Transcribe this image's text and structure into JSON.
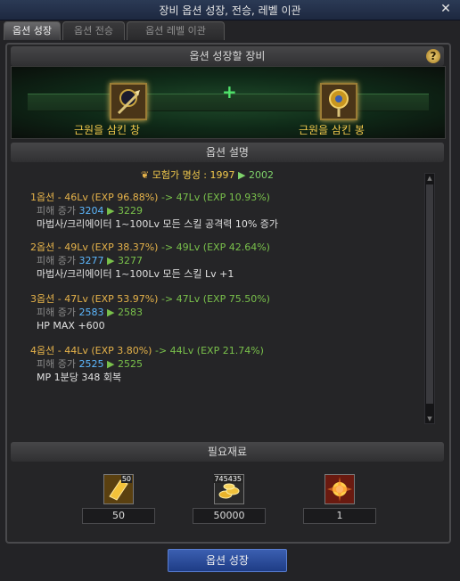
{
  "window": {
    "title": "장비 옵션 성장, 전승, 레벨 이관"
  },
  "tabs": [
    {
      "label": "옵션 성장",
      "active": true
    },
    {
      "label": "옵션 전승",
      "active": false
    },
    {
      "label": "옵션 레벨 이관",
      "active": false
    }
  ],
  "equipment": {
    "header": "옵션 성장할 장비",
    "help_icon": "?",
    "left_item": "근원을 삼킨 창",
    "right_item": "근원을 삼킨 봉",
    "plus": "+"
  },
  "description": {
    "header": "옵션 설명",
    "reputation": {
      "label": "모험가 명성 : 1997",
      "arrow": "▶",
      "next": "2002"
    },
    "options": [
      {
        "head": "1옵션 - 46Lv (EXP 96.88%)",
        "to": "-> 47Lv (EXP 10.93%)",
        "dmg_label": "피해 증가",
        "dmg_cur": "3204",
        "arrow": "▶",
        "dmg_next": "3229",
        "effect": "마법사/크리에이터 1~100Lv 모든 스킬 공격력 10% 증가"
      },
      {
        "head": "2옵션 - 49Lv (EXP 38.37%)",
        "to": "-> 49Lv (EXP 42.64%)",
        "dmg_label": "피해 증가",
        "dmg_cur": "3277",
        "arrow": "▶",
        "dmg_next": "3277",
        "effect": "마법사/크리에이터 1~100Lv 모든 스킬 Lv +1"
      },
      {
        "head": "3옵션 - 47Lv (EXP 53.97%)",
        "to": "-> 47Lv (EXP 75.50%)",
        "dmg_label": "피해 증가",
        "dmg_cur": "2583",
        "arrow": "▶",
        "dmg_next": "2583",
        "effect": "HP MAX +600"
      },
      {
        "head": "4옵션 - 44Lv (EXP 3.80%)",
        "to": "-> 44Lv (EXP 21.74%)",
        "dmg_label": "피해 증가",
        "dmg_cur": "2525",
        "arrow": "▶",
        "dmg_next": "2525",
        "effect": "MP 1분당 348 회복"
      }
    ]
  },
  "materials": {
    "header": "필요재료",
    "items": [
      {
        "badge": "50",
        "count": "50",
        "icon": "gold-card-icon"
      },
      {
        "badge": "745435",
        "count": "50000",
        "icon": "gold-coins-icon"
      },
      {
        "badge": "",
        "count": "1",
        "icon": "burst-orb-icon"
      }
    ]
  },
  "action": {
    "label": "옵션 성장"
  },
  "colors": {
    "accent_gold": "#f2c94c",
    "green": "#79c04b",
    "blue_value": "#5db8ff",
    "button": "#2a4a9a"
  }
}
